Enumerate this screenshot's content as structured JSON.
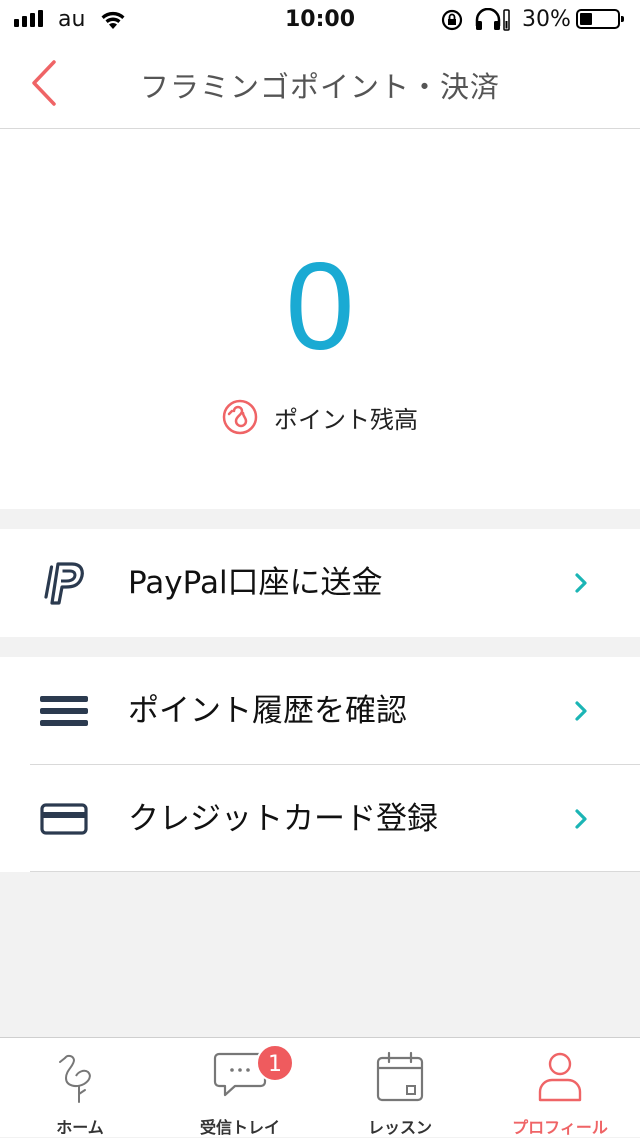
{
  "status_bar": {
    "carrier": "au",
    "time": "10:00",
    "battery_percent": "30%",
    "battery_level": 0.3
  },
  "nav": {
    "title": "フラミンゴポイント・決済",
    "back_icon": "chevron-left-icon"
  },
  "points": {
    "value": "0",
    "label": "ポイント残高",
    "icon": "flamingo-coin-icon"
  },
  "menu": {
    "paypal": {
      "label": "PayPal口座に送金",
      "icon": "paypal-icon"
    },
    "history": {
      "label": "ポイント履歴を確認",
      "icon": "list-icon"
    },
    "credit_card": {
      "label": "クレジットカード登録",
      "icon": "credit-card-icon"
    }
  },
  "tabs": [
    {
      "label": "ホーム",
      "icon": "flamingo-icon"
    },
    {
      "label": "受信トレイ",
      "icon": "chat-bubble-icon",
      "badge": "1"
    },
    {
      "label": "レッスン",
      "icon": "calendar-icon"
    },
    {
      "label": "プロフィール",
      "icon": "person-icon",
      "active": true
    }
  ],
  "colors": {
    "accent": "#ef6466",
    "points_blue": "#1aaad3",
    "chevron_teal": "#1bb5b5",
    "icon_navy": "#2b3a4f"
  }
}
